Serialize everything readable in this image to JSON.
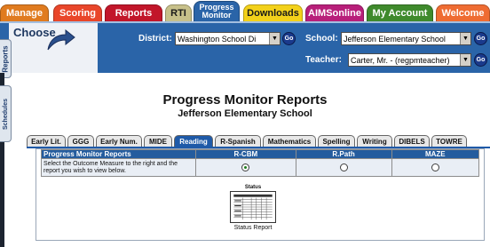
{
  "topnav": {
    "tabs": [
      {
        "label": "Manage",
        "color": "#e07b1f"
      },
      {
        "label": "Scoring",
        "color": "#e9462a"
      },
      {
        "label": "Reports",
        "color": "#c2162a"
      },
      {
        "label": "RTI",
        "color": "#c7c08a"
      },
      {
        "label": "Progress Monitor",
        "line1": "Progress",
        "line2": "Monitor",
        "color": "#2a64a8",
        "active": true
      },
      {
        "label": "Downloads",
        "color": "#f3d11a"
      },
      {
        "label": "AIMSonline",
        "color": "#b81f7a"
      },
      {
        "label": "My Account",
        "color": "#3f8a2c"
      },
      {
        "label": "Welcome",
        "color": "#ef6c32"
      }
    ]
  },
  "side_tabs": {
    "reports": "Reports",
    "schedules": "Schedules"
  },
  "choose": {
    "label": "Choose"
  },
  "filters": {
    "district_label": "District:",
    "district_value": "Washington School Di",
    "school_label": "School:",
    "school_value": "Jefferson Elementary School",
    "teacher_label": "Teacher:",
    "teacher_value": "Carter, Mr. - (regpmteacher)",
    "go_label": "Go"
  },
  "main": {
    "title": "Progress Monitor Reports",
    "subtitle": "Jefferson Elementary School"
  },
  "subtabs": [
    "Early Lit.",
    "GGG",
    "Early Num.",
    "MIDE",
    "Reading",
    "R-Spanish",
    "Mathematics",
    "Spelling",
    "Writing",
    "DIBELS",
    "TOWRE"
  ],
  "active_subtab": "Reading",
  "report_table": {
    "header": "Progress Monitor Reports",
    "columns": [
      "R-CBM",
      "R.Path",
      "MAZE"
    ],
    "instruction": "Select the Outcome Measure to the right and the report you wish to view below.",
    "selected_column": "R-CBM"
  },
  "thumbnail": {
    "title": "Status",
    "caption": "Status Report"
  },
  "colors": {
    "header_blue": "#2a64a8",
    "table_header": "#245c9e"
  }
}
